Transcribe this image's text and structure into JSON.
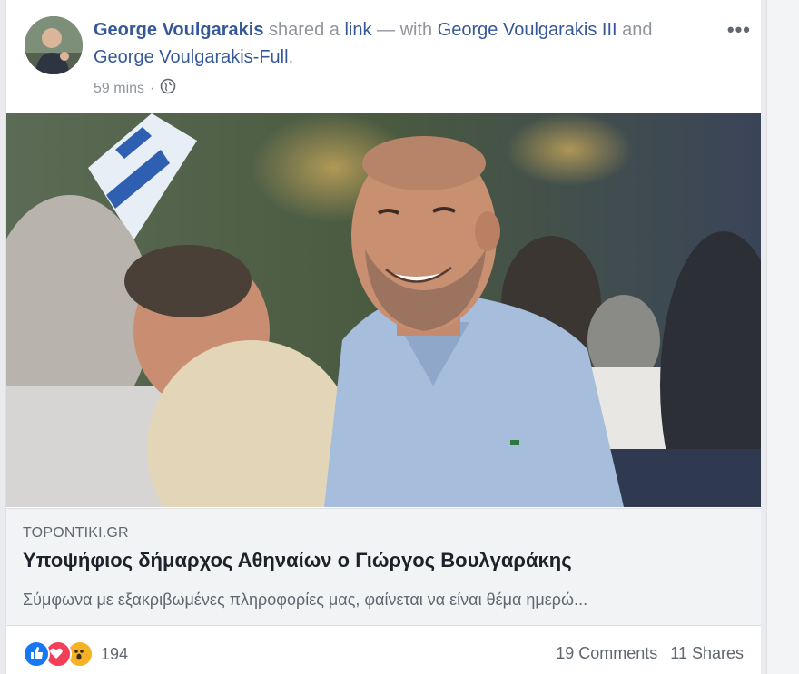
{
  "post": {
    "actor_name": "George Voulgarakis",
    "action_text": " shared a ",
    "link_word": "link",
    "with_text": " — with ",
    "tagged_1": "George Voulgarakis III",
    "and_text": " and ",
    "tagged_2": "George Voulgarakis-Full",
    "period": ".",
    "time": "59 mins",
    "separator": "·",
    "privacy_icon": "globe-icon",
    "more_icon": "more-options-icon",
    "more_glyph": "•••"
  },
  "link_preview": {
    "domain": "TOPONTIKI.GR",
    "headline": "Υποψήφιος δήμαρχος Αθηναίων ο Γιώργος Βουλγαράκης",
    "snippet": "Σύμφωνα με εξακριβωμένες πληροφορίες μας, φαίνεται να είναι θέμα ημερώ..."
  },
  "footer": {
    "reaction_icons": [
      "like-icon",
      "love-icon",
      "wow-icon"
    ],
    "reaction_count": "194",
    "comments": "19 Comments",
    "shares": "11 Shares"
  },
  "colors": {
    "link_blue": "#365899",
    "like_blue": "#1877f2",
    "love_red": "#f33e58",
    "wow_yellow": "#f7b125"
  }
}
